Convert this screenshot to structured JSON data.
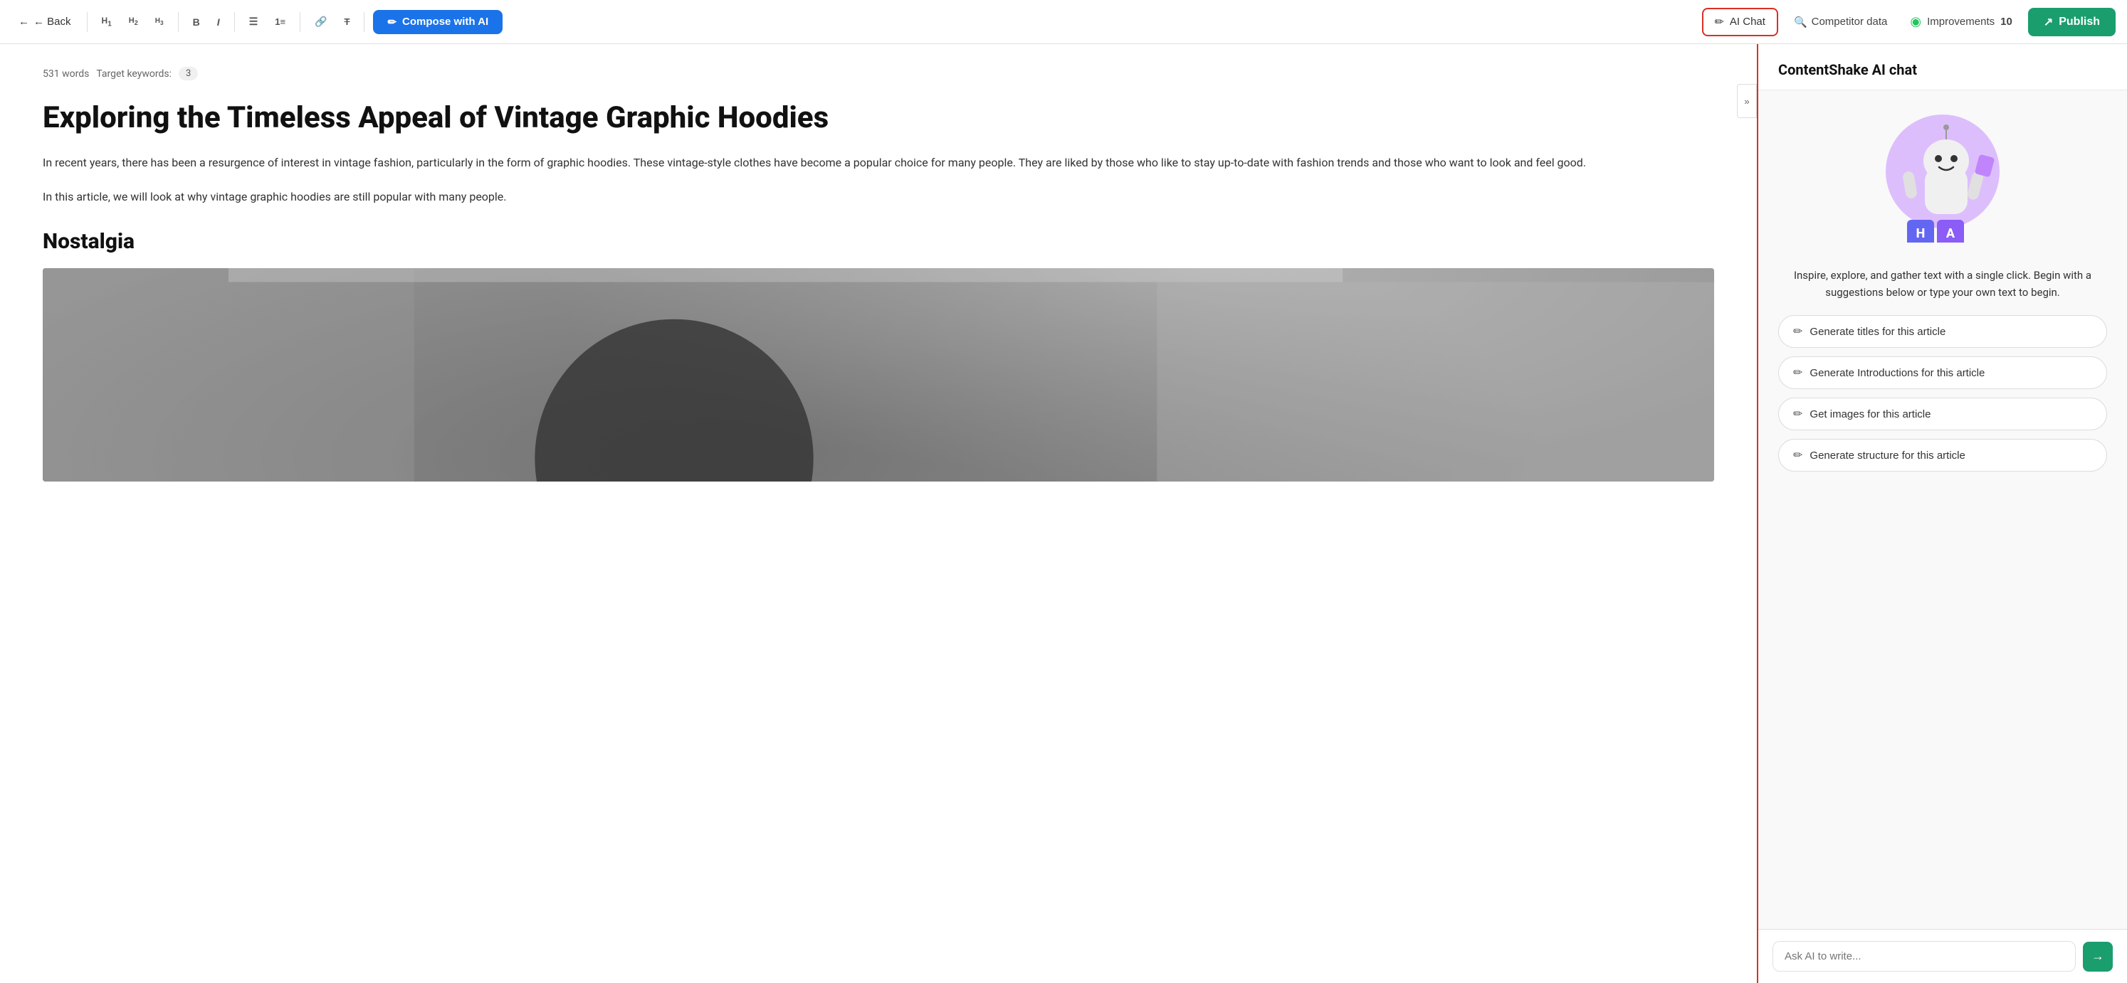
{
  "toolbar": {
    "back_label": "← Back",
    "h1_label": "H₁",
    "h2_label": "H₂",
    "h3_label": "H₃",
    "bold_label": "B",
    "italic_label": "I",
    "bullet_label": "≡",
    "number_label": "≡",
    "link_label": "🔗",
    "clear_label": "Tx",
    "compose_label": "Compose with AI",
    "ai_chat_label": "AI Chat",
    "competitor_label": "Competitor data",
    "improvements_label": "Improvements",
    "improvements_count": "10",
    "publish_label": "Publish"
  },
  "editor": {
    "word_count": "531 words",
    "target_keywords_label": "Target keywords:",
    "keyword_count": "3",
    "article_title": "Exploring the Timeless Appeal of Vintage Graphic Hoodies",
    "paragraph1": "In recent years, there has been a resurgence of interest in vintage fashion, particularly in the form of graphic hoodies. These vintage-style clothes have become a popular choice for many people. They are liked by those who like to stay up-to-date with fashion trends and those who want to look and feel good.",
    "paragraph2": "In this article, we will look at why vintage graphic hoodies are still popular with many people.",
    "section_heading": "Nostalgia"
  },
  "ai_chat": {
    "panel_title": "ContentShake AI chat",
    "description": "Inspire, explore, and gather text with a single click. Begin with a suggestions below or type your own text to begin.",
    "suggestions": [
      {
        "id": "titles",
        "label": "Generate titles for this article"
      },
      {
        "id": "introductions",
        "label": "Generate Introductions for this article"
      },
      {
        "id": "images",
        "label": "Get images for this article"
      },
      {
        "id": "structure",
        "label": "Generate structure for this article"
      }
    ],
    "input_placeholder": "Ask AI to write...",
    "send_label": "→"
  },
  "icons": {
    "back_arrow": "←",
    "pencil": "✏",
    "search": "🔍",
    "circle_check": "◎",
    "arrow_right": "→"
  }
}
